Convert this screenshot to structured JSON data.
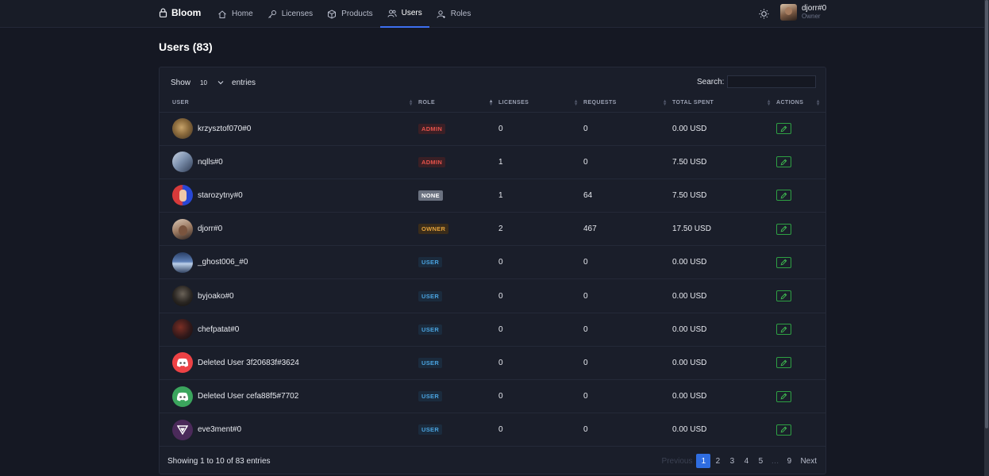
{
  "nav": {
    "brand": "Bloom",
    "items": [
      {
        "label": "Home",
        "icon": "home-icon",
        "active": false
      },
      {
        "label": "Licenses",
        "icon": "key-icon",
        "active": false
      },
      {
        "label": "Products",
        "icon": "box-icon",
        "active": false
      },
      {
        "label": "Users",
        "icon": "users-icon",
        "active": true
      },
      {
        "label": "Roles",
        "icon": "user-role-icon",
        "active": false
      }
    ],
    "user": {
      "name": "djorr#0",
      "role": "Owner"
    }
  },
  "page": {
    "title": "Users (83)"
  },
  "table_controls": {
    "show_label": "Show",
    "entries_value": "10",
    "entries_label": "entries",
    "search_label": "Search:",
    "search_value": ""
  },
  "columns": [
    "USER",
    "ROLE",
    "LICENSES",
    "REQUESTS",
    "TOTAL SPENT",
    "ACTIONS"
  ],
  "rows": [
    {
      "user": "krzysztof070#0",
      "role": "ADMIN",
      "licenses": "0",
      "requests": "0",
      "total_spent": "0.00 USD",
      "avatar": "photo-brown"
    },
    {
      "user": "nqlls#0",
      "role": "ADMIN",
      "licenses": "1",
      "requests": "0",
      "total_spent": "7.50 USD",
      "avatar": "photo-blue"
    },
    {
      "user": "starozytny#0",
      "role": "NONE",
      "licenses": "1",
      "requests": "64",
      "total_spent": "7.50 USD",
      "avatar": "photo-red-blue"
    },
    {
      "user": "djorr#0",
      "role": "OWNER",
      "licenses": "2",
      "requests": "467",
      "total_spent": "17.50 USD",
      "avatar": "photo-portrait"
    },
    {
      "user": "_ghost006_#0",
      "role": "USER",
      "licenses": "0",
      "requests": "0",
      "total_spent": "0.00 USD",
      "avatar": "photo-landscape"
    },
    {
      "user": "byjoako#0",
      "role": "USER",
      "licenses": "0",
      "requests": "0",
      "total_spent": "0.00 USD",
      "avatar": "photo-dark"
    },
    {
      "user": "chefpatat#0",
      "role": "USER",
      "licenses": "0",
      "requests": "0",
      "total_spent": "0.00 USD",
      "avatar": "photo-dark-red"
    },
    {
      "user": "Deleted User 3f20683f#3624",
      "role": "USER",
      "licenses": "0",
      "requests": "0",
      "total_spent": "0.00 USD",
      "avatar": "discord-red"
    },
    {
      "user": "Deleted User cefa88f5#7702",
      "role": "USER",
      "licenses": "0",
      "requests": "0",
      "total_spent": "0.00 USD",
      "avatar": "discord-green"
    },
    {
      "user": "eve3ment#0",
      "role": "USER",
      "licenses": "0",
      "requests": "0",
      "total_spent": "0.00 USD",
      "avatar": "logo-purple"
    }
  ],
  "role_colors": {
    "ADMIN": {
      "text": "#e5534b",
      "bg": "#3a1f25"
    },
    "NONE": {
      "text": "#ffffff",
      "bg": "#6b7280"
    },
    "OWNER": {
      "text": "#e3a23b",
      "bg": "#3a2c1a"
    },
    "USER": {
      "text": "#4aa3e0",
      "bg": "#1b2b3d"
    }
  },
  "footer": {
    "info": "Showing 1 to 10 of 83 entries",
    "pagination": [
      "Previous",
      "1",
      "2",
      "3",
      "4",
      "5",
      "…",
      "9",
      "Next"
    ],
    "active_page": "1"
  },
  "colors": {
    "accent": "#2f6de0",
    "edit": "#2ea043",
    "background": "#151823"
  }
}
